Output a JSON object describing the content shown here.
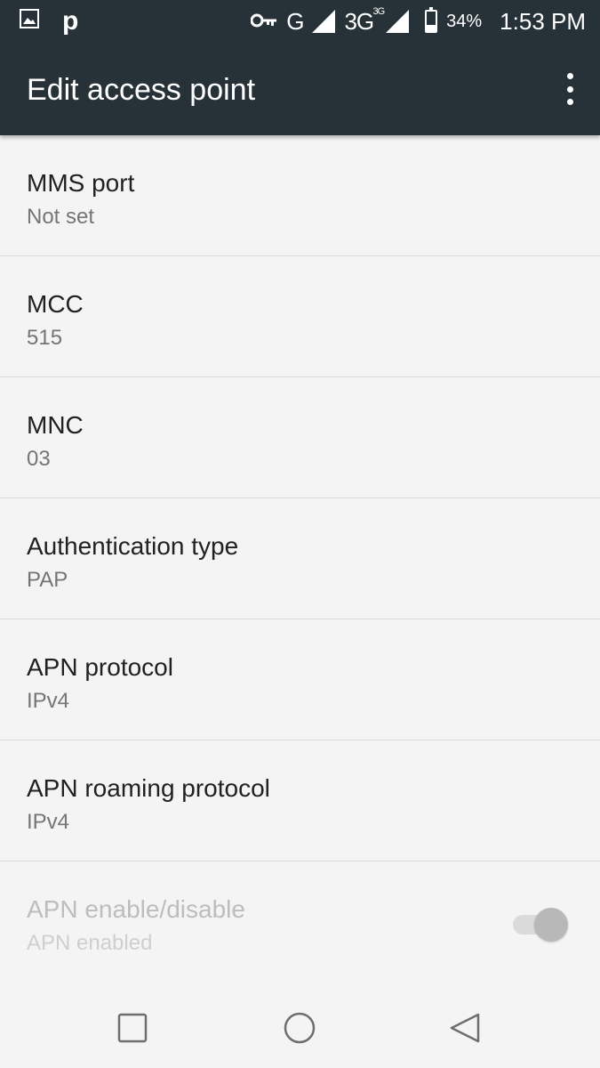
{
  "status_bar": {
    "left_icons": [
      "picture-notification-icon",
      "p-app-notification-icon"
    ],
    "p_app_letter": "p",
    "vpn_key_icon": "key-icon",
    "network_primary": "G",
    "network_secondary": "3G",
    "network_secondary_sup": "3G",
    "battery_percent": "34%",
    "battery_level": 0.34,
    "time": "1:53 PM"
  },
  "app_bar": {
    "title": "Edit access point",
    "menu_icon": "more-vert-icon"
  },
  "settings": [
    {
      "title": "MMS port",
      "value": "Not set"
    },
    {
      "title": "MCC",
      "value": "515"
    },
    {
      "title": "MNC",
      "value": "03"
    },
    {
      "title": "Authentication type",
      "value": "PAP"
    },
    {
      "title": "APN protocol",
      "value": "IPv4"
    },
    {
      "title": "APN roaming protocol",
      "value": "IPv4"
    }
  ],
  "apn_toggle": {
    "title": "APN enable/disable",
    "value": "APN enabled",
    "checked": true,
    "disabled": true
  },
  "nav_bar": [
    "recent-apps-icon",
    "home-icon",
    "back-icon"
  ],
  "colors": {
    "app_bar_bg": "#263238",
    "background": "#f4f4f4"
  }
}
